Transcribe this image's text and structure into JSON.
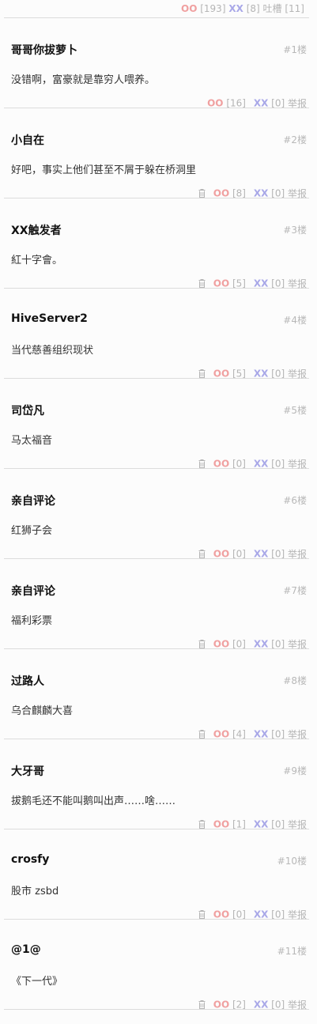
{
  "summary": {
    "oo_label": "OO",
    "oo_count": "[193]",
    "xx_label": "XX",
    "xx_count": "[8]",
    "tucao_label": "吐槽",
    "tucao_count": "[11]"
  },
  "labels": {
    "oo": "OO",
    "xx": "XX",
    "report": "举报"
  },
  "comments": [
    {
      "author": "哥哥你拔萝卜",
      "floor": "#1楼",
      "content": "没错啊，富豪就是靠穷人喂养。",
      "oo": "[16]",
      "xx": "[0]",
      "deletable": false
    },
    {
      "author": "小自在",
      "floor": "#2楼",
      "content": "好吧，事实上他们甚至不屑于躲在桥洞里",
      "oo": "[8]",
      "xx": "[0]",
      "deletable": true
    },
    {
      "author": "XX触发者",
      "floor": "#3楼",
      "content": "紅十字會。",
      "oo": "[5]",
      "xx": "[0]",
      "deletable": true
    },
    {
      "author": "HiveServer2",
      "floor": "#4楼",
      "content": "当代慈善组织现状",
      "oo": "[5]",
      "xx": "[0]",
      "deletable": true
    },
    {
      "author": "司岱凡",
      "floor": "#5楼",
      "content": "马太福音",
      "oo": "[0]",
      "xx": "[0]",
      "deletable": true
    },
    {
      "author": "亲自评论",
      "floor": "#6楼",
      "content": "红狮子会",
      "oo": "[0]",
      "xx": "[0]",
      "deletable": true
    },
    {
      "author": "亲自评论",
      "floor": "#7楼",
      "content": "福利彩票",
      "oo": "[0]",
      "xx": "[0]",
      "deletable": true
    },
    {
      "author": "过路人",
      "floor": "#8楼",
      "content": "乌合麒麟大喜",
      "oo": "[4]",
      "xx": "[0]",
      "deletable": true
    },
    {
      "author": "大牙哥",
      "floor": "#9楼",
      "content": "拔鹅毛还不能叫鹅叫出声……啥……",
      "oo": "[1]",
      "xx": "[0]",
      "deletable": true
    },
    {
      "author": "crosfy",
      "floor": "#10楼",
      "content": "股市 zsbd",
      "oo": "[0]",
      "xx": "[0]",
      "deletable": true
    },
    {
      "author": "@1@",
      "floor": "#11楼",
      "content": "《下一代》",
      "oo": "[2]",
      "xx": "[0]",
      "deletable": true
    }
  ]
}
